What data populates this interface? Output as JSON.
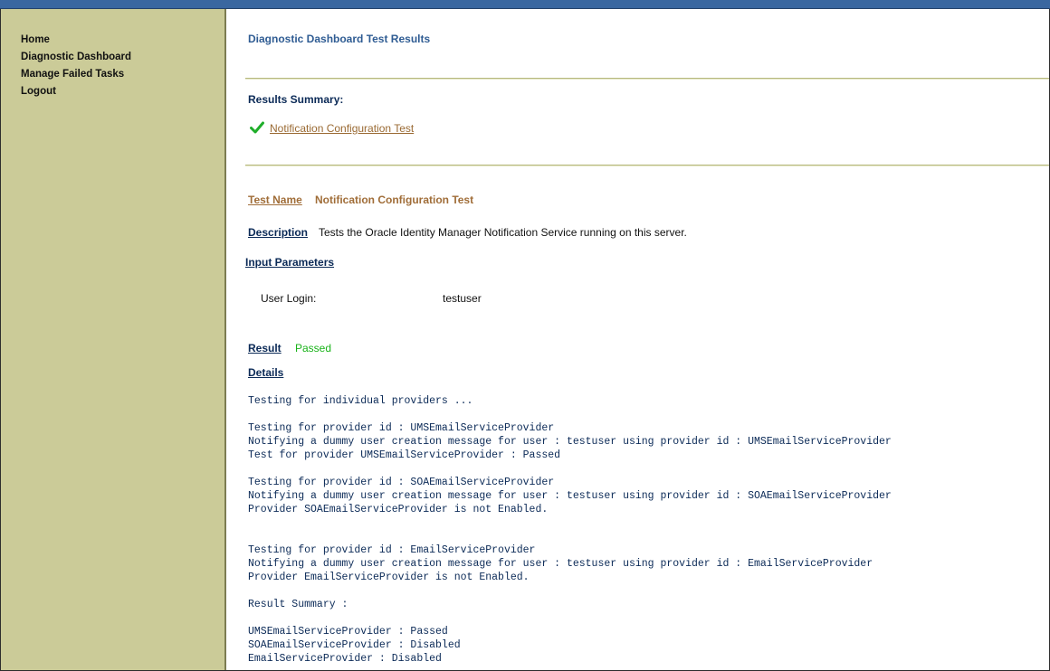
{
  "sidebar": {
    "items": [
      {
        "label": "Home"
      },
      {
        "label": "Diagnostic Dashboard"
      },
      {
        "label": "Manage Failed Tasks"
      },
      {
        "label": "Logout"
      }
    ]
  },
  "page": {
    "title": "Diagnostic Dashboard Test Results"
  },
  "results_summary": {
    "title": "Results Summary:",
    "tests": [
      {
        "name": "Notification Configuration Test",
        "status_icon": "check-icon"
      }
    ]
  },
  "test": {
    "name_label": "Test Name",
    "name": "Notification Configuration Test",
    "description_label": "Description",
    "description": "Tests the Oracle Identity Manager Notification Service running on this server.",
    "input_params_label": "Input Parameters",
    "params": [
      {
        "name": "User Login:",
        "value": "testuser"
      }
    ],
    "result_label": "Result",
    "result": "Passed",
    "details_label": "Details",
    "details": "Testing for individual providers ...\n\nTesting for provider id : UMSEmailServiceProvider\nNotifying a dummy user creation message for user : testuser using provider id : UMSEmailServiceProvider\nTest for provider UMSEmailServiceProvider : Passed\n\nTesting for provider id : SOAEmailServiceProvider\nNotifying a dummy user creation message for user : testuser using provider id : SOAEmailServiceProvider\nProvider SOAEmailServiceProvider is not Enabled.\n\n\nTesting for provider id : EmailServiceProvider\nNotifying a dummy user creation message for user : testuser using provider id : EmailServiceProvider\nProvider EmailServiceProvider is not Enabled.\n\nResult Summary :\n\nUMSEmailServiceProvider : Passed\nSOAEmailServiceProvider : Disabled\nEmailServiceProvider : Disabled"
  },
  "colors": {
    "topbar": "#3a67a0",
    "sidebar": "#cbcb98",
    "title_blue": "#2f5c93",
    "label_navy": "#0b2a57",
    "label_brown": "#a06d38",
    "passed_green": "#19b319"
  }
}
